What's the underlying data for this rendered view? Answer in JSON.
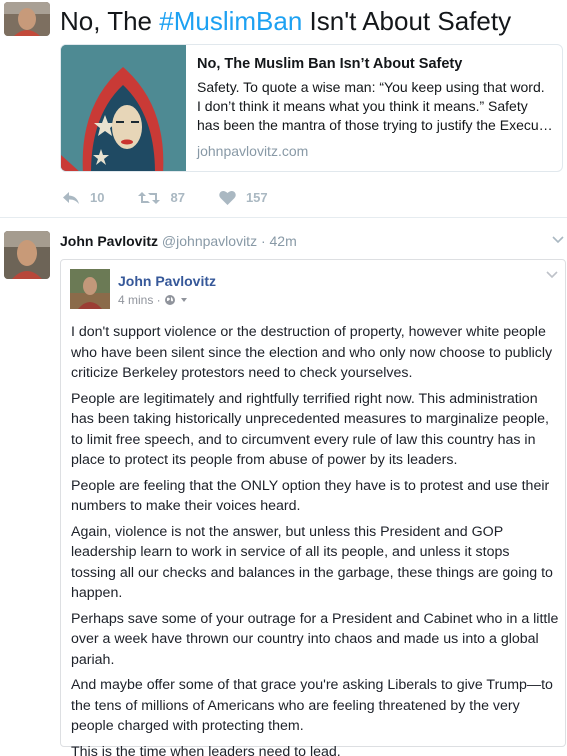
{
  "tweet1": {
    "text_plain": "No, The ",
    "hashtag": "#MuslimBan",
    "text_rest": " Isn't About Safety",
    "card": {
      "title": "No, The Muslim Ban Isn’t About Safety",
      "desc_lines": [
        "Safety. To quote a wise man: “You keep using that word.",
        "I don’t think it means what you think it means.” Safety",
        "has been the mantra of those trying to justify the Execu…"
      ],
      "domain": "johnpavlovitz.com"
    },
    "actions": {
      "reply": "10",
      "retweet": "87",
      "like": "157"
    }
  },
  "tweet2": {
    "name": "John Pavlovitz",
    "handle": "@johnpavlovitz",
    "time": " · 42m",
    "fb": {
      "name": "John Pavlovitz",
      "time": "4 mins ·",
      "paragraphs": [
        [
          "I don't support violence or the destruction of property, however white people",
          "who have been silent since the election and who only now choose to publicly",
          "criticize Berkeley protestors need to check yourselves."
        ],
        [
          "People are legitimately and rightfully terrified right now. This administration",
          "has been taking historically unprecedented measures to marginalize people,",
          "to limit free speech, and to circumvent every rule of law this country has in",
          "place to protect its people from abuse of power by its leaders."
        ],
        [
          "People are feeling that the ONLY option they have is to protest and use their",
          "numbers to make their voices heard."
        ],
        [
          "Again, violence is not the answer, but unless this President and GOP",
          "leadership learn to work in service of all its people, and unless it stops",
          "tossing all our checks and balances in the garbage, these things are going to",
          "happen."
        ],
        [
          "Perhaps save some of your outrage for a President and Cabinet who in a little",
          "over a week have thrown our country into chaos and made us into a global",
          "pariah."
        ],
        [
          "And maybe offer some of that grace you're asking Liberals to give Trump—to",
          "the tens of millions of Americans who are feeling threatened by the very",
          "people charged with protecting them."
        ],
        [
          "This is the time when leaders need to lead."
        ]
      ]
    }
  },
  "colors": {
    "link": "#1da1f2",
    "fb_name": "#365899",
    "muted": "#8899a6",
    "icon": "#aab8c2"
  },
  "icons": [
    "reply-icon",
    "retweet-icon",
    "heart-icon",
    "globe-icon",
    "chevron-down-icon"
  ]
}
